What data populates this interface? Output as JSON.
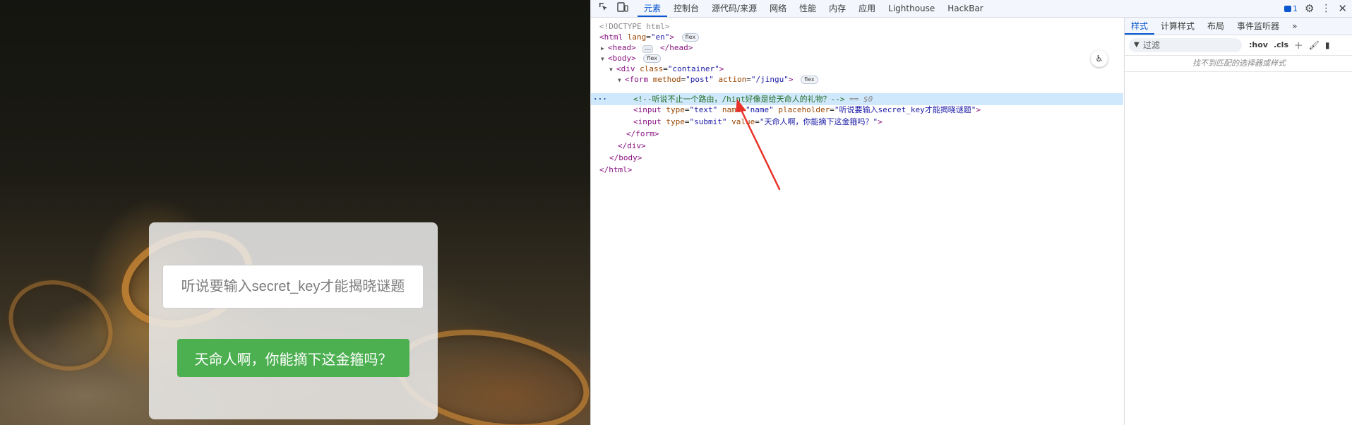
{
  "webpage": {
    "input_placeholder": "听说要输入secret_key才能揭晓谜题",
    "submit_value": "天命人啊，你能摘下这金箍吗？"
  },
  "devtools": {
    "tabs": [
      "元素",
      "控制台",
      "源代码/来源",
      "网络",
      "性能",
      "内存",
      "应用",
      "Lighthouse",
      "HackBar"
    ],
    "active_tab": "元素",
    "issues_count": "1",
    "dom": {
      "doctype": "<!DOCTYPE html>",
      "html_open_tag": "<html",
      "html_lang_attr": "lang",
      "html_lang_val": "\"en\"",
      "head": "<head>",
      "head_close": "</head>",
      "body_open": "<body>",
      "div_open_tag": "<div",
      "div_class_attr": "class",
      "div_class_val": "\"container\"",
      "form_open_tag": "<form",
      "form_method_attr": "method",
      "form_method_val": "\"post\"",
      "form_action_attr": "action",
      "form_action_val": "\"/jingu\"",
      "comment": "<!--听说不止一个路由，/hint好像是给天命人的礼物？-->",
      "selected_suffix": "== $0",
      "input1_tag": "<input",
      "input1_type_attr": "type",
      "input1_type_val": "\"text\"",
      "input1_name_attr": "name",
      "input1_name_val": "\"name\"",
      "input1_ph_attr": "placeholder",
      "input1_ph_val": "\"听说要输入secret_key才能揭晓谜题\"",
      "input2_tag": "<input",
      "input2_type_attr": "type",
      "input2_type_val": "\"submit\"",
      "input2_value_attr": "value",
      "input2_value_val": "\"天命人啊，你能摘下这金箍吗？\"",
      "form_close": "</form>",
      "div_close": "</div>",
      "body_close": "</body>",
      "html_close": "</html>",
      "flex_badge": "flex",
      "ellipsis": "…",
      "row_dots": "···"
    },
    "styles_pane": {
      "tabs": [
        "样式",
        "计算样式",
        "布局",
        "事件监听器"
      ],
      "more": "»",
      "filter_placeholder": "过滤",
      "hov": ":hov",
      "cls": ".cls",
      "no_match": "找不到匹配的选择器或样式"
    },
    "accent_color": "#0b57d0",
    "annotation_arrow_color": "#e8332a"
  }
}
